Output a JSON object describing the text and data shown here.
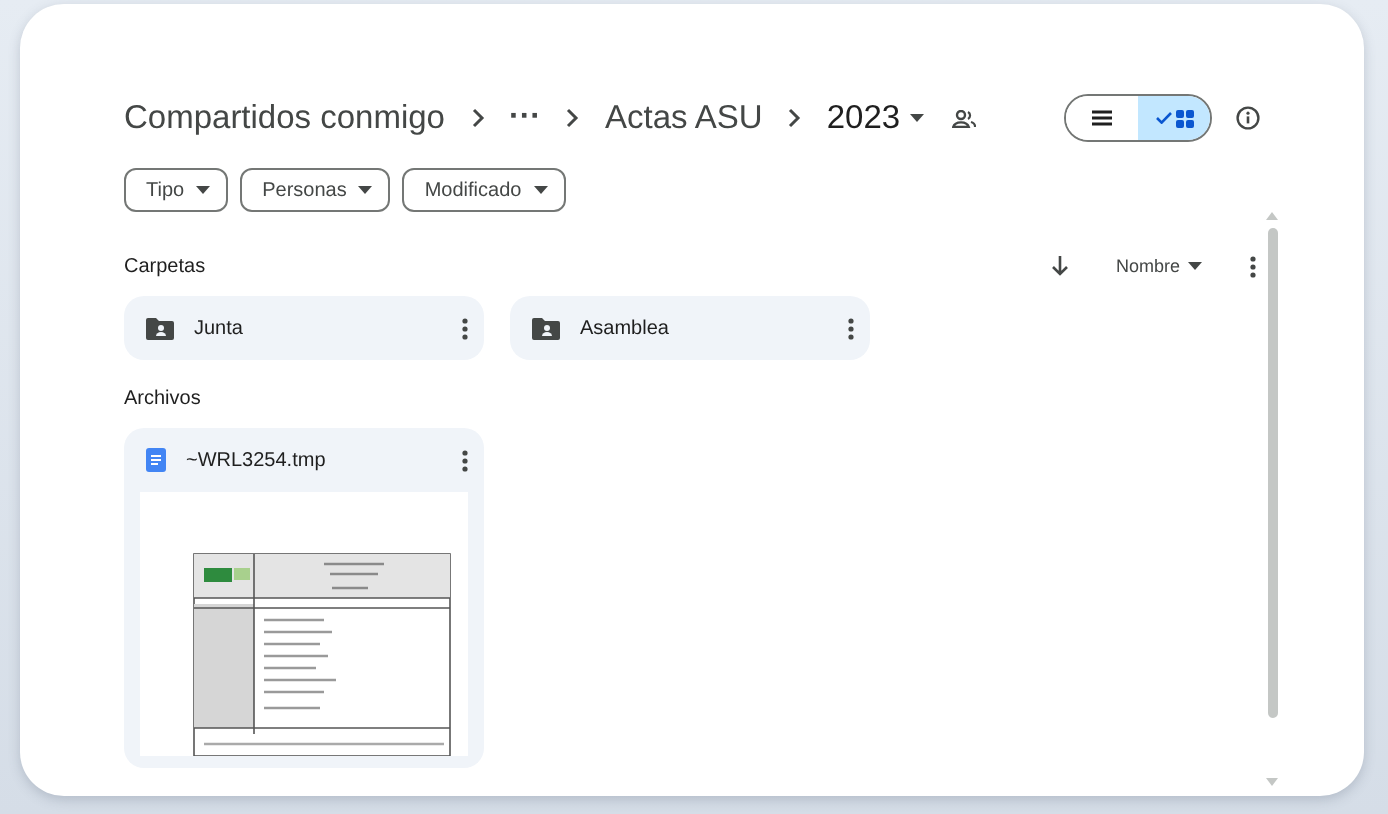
{
  "breadcrumb": {
    "root": "Compartidos conmigo",
    "ellipsis": "···",
    "parent": "Actas ASU",
    "current": "2023",
    "shared": true
  },
  "view_toggle": [
    {
      "kind": "list",
      "selected": false
    },
    {
      "kind": "grid",
      "selected": true
    }
  ],
  "filters": [
    {
      "label": "Tipo"
    },
    {
      "label": "Personas"
    },
    {
      "label": "Modificado"
    }
  ],
  "sort": {
    "label": "Nombre"
  },
  "folders_section": {
    "title": "Carpetas",
    "items": [
      {
        "name": "Junta"
      },
      {
        "name": "Asamblea"
      }
    ]
  },
  "files_section": {
    "title": "Archivos",
    "items": [
      {
        "name": "~WRL3254.tmp"
      }
    ]
  }
}
